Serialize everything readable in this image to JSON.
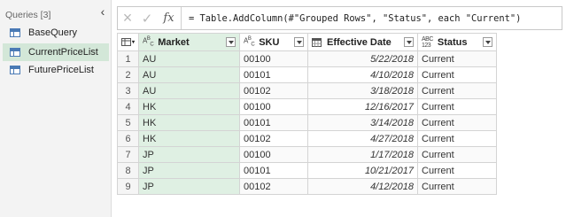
{
  "queries": {
    "header": "Queries [3]",
    "items": [
      {
        "label": "BaseQuery",
        "selected": false
      },
      {
        "label": "CurrentPriceList",
        "selected": true
      },
      {
        "label": "FuturePriceList",
        "selected": false
      }
    ]
  },
  "formula": {
    "cancel_icon": "×",
    "confirm_icon": "✓",
    "fx_label": "fx",
    "text": "= Table.AddColumn(#\"Grouped Rows\", \"Status\", each \"Current\")"
  },
  "grid": {
    "columns": [
      {
        "label": "Market",
        "type_icon": "text-type-icon"
      },
      {
        "label": "SKU",
        "type_icon": "text-type-icon"
      },
      {
        "label": "Effective Date",
        "type_icon": "date-type-icon"
      },
      {
        "label": "Status",
        "type_icon": "any-type-icon"
      }
    ],
    "rows": [
      {
        "num": "1",
        "market": "AU",
        "sku": "00100",
        "date": "5/22/2018",
        "status": "Current"
      },
      {
        "num": "2",
        "market": "AU",
        "sku": "00101",
        "date": "4/10/2018",
        "status": "Current"
      },
      {
        "num": "3",
        "market": "AU",
        "sku": "00102",
        "date": "3/18/2018",
        "status": "Current"
      },
      {
        "num": "4",
        "market": "HK",
        "sku": "00100",
        "date": "12/16/2017",
        "status": "Current"
      },
      {
        "num": "5",
        "market": "HK",
        "sku": "00101",
        "date": "3/14/2018",
        "status": "Current"
      },
      {
        "num": "6",
        "market": "HK",
        "sku": "00102",
        "date": "4/27/2018",
        "status": "Current"
      },
      {
        "num": "7",
        "market": "JP",
        "sku": "00100",
        "date": "1/17/2018",
        "status": "Current"
      },
      {
        "num": "8",
        "market": "JP",
        "sku": "00101",
        "date": "10/21/2017",
        "status": "Current"
      },
      {
        "num": "9",
        "market": "JP",
        "sku": "00102",
        "date": "4/12/2018",
        "status": "Current"
      }
    ]
  },
  "colors": {
    "selected_query_bg": "#d3e7d8",
    "market_column_bg": "#dff0e3",
    "pane_bg": "#f3f3f3"
  }
}
